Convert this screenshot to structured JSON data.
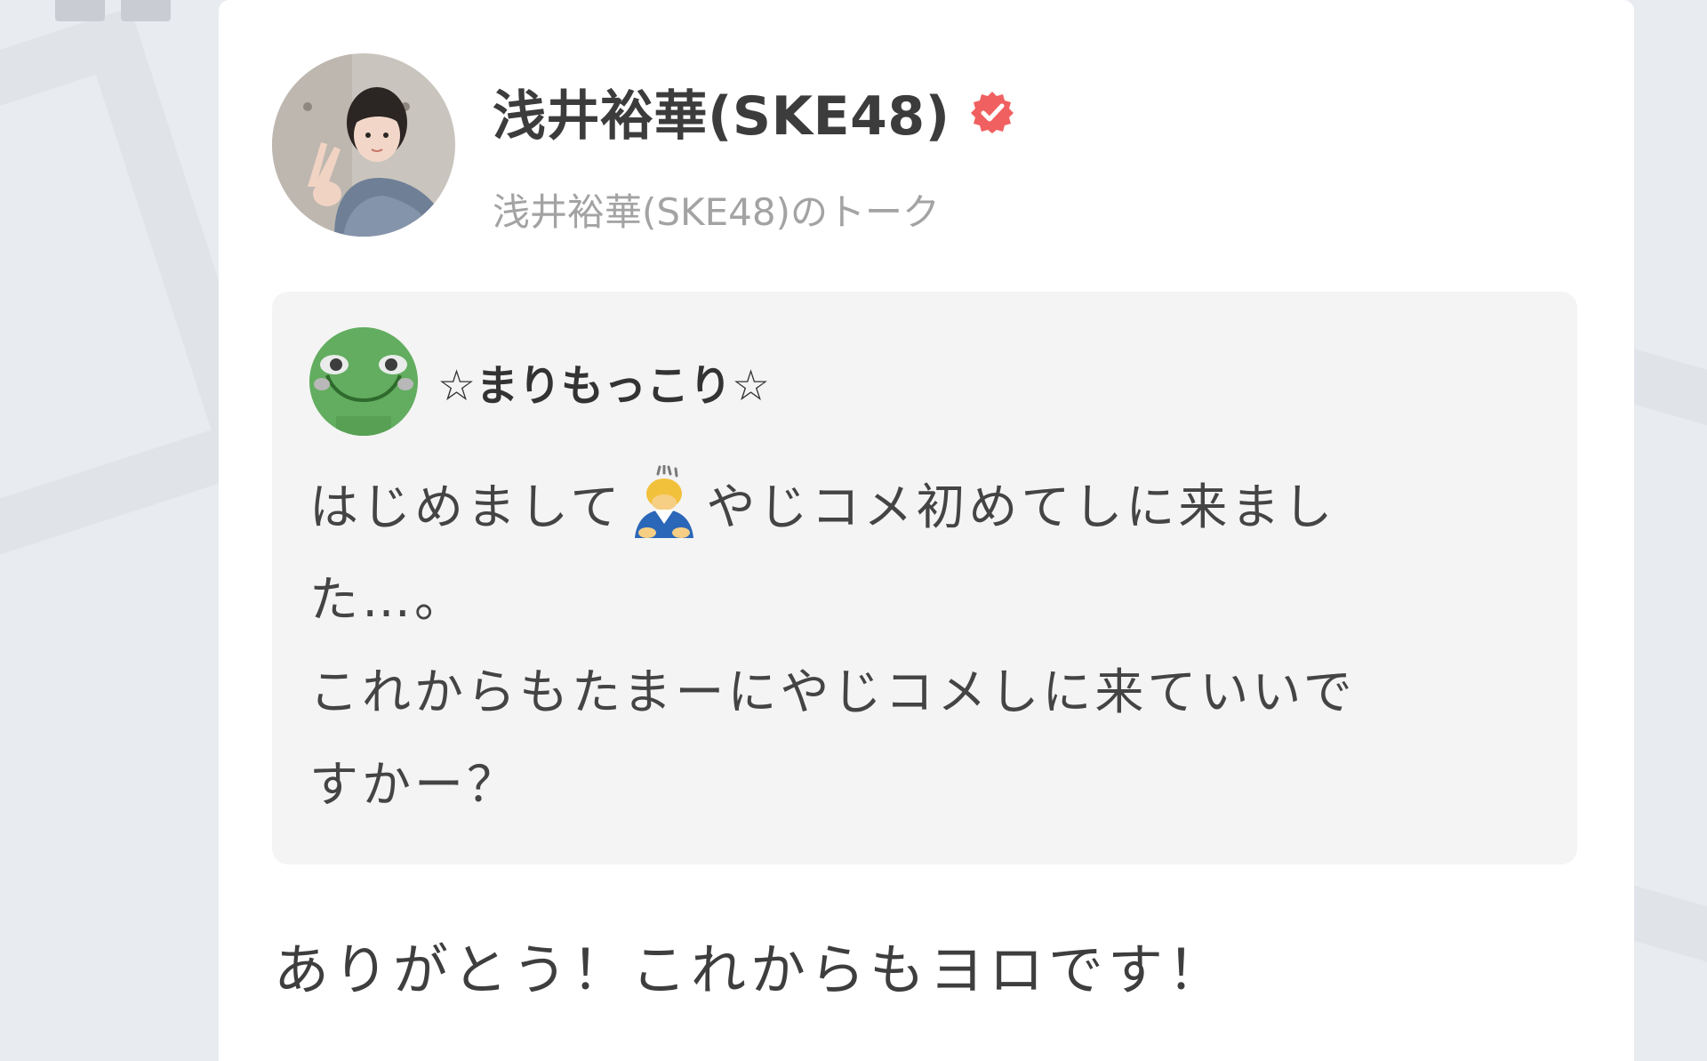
{
  "profile": {
    "name": "浅井裕華(SKE48)",
    "subtitle": "浅井裕華(SKE48)のトーク",
    "verified_color": "#f06060"
  },
  "quoted_comment": {
    "author": "☆まりもっこり☆",
    "line1_before_icon": "はじめまして",
    "icon": "person-bowing-icon",
    "line1_after_icon": "やじコメ初めてしに来まし",
    "line2": "た…。",
    "line3": "これからもたまーにやじコメしに来ていいで",
    "line4": "すかー？"
  },
  "reply": {
    "text": "ありがとう！これからもヨロです！"
  }
}
